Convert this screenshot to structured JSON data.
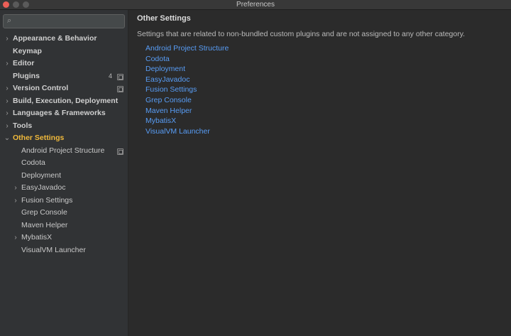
{
  "window": {
    "title": "Preferences"
  },
  "search": {
    "placeholder": "",
    "value": ""
  },
  "sidebar": {
    "items": [
      {
        "label": "Appearance & Behavior",
        "level": 0,
        "chevron": "›"
      },
      {
        "label": "Keymap",
        "level": 0,
        "chevron": ""
      },
      {
        "label": "Editor",
        "level": 0,
        "chevron": "›"
      },
      {
        "label": "Plugins",
        "level": 0,
        "chevron": "",
        "badge": "4",
        "copy_icon": true
      },
      {
        "label": "Version Control",
        "level": 0,
        "chevron": "›",
        "copy_icon": true
      },
      {
        "label": "Build, Execution, Deployment",
        "level": 0,
        "chevron": "›"
      },
      {
        "label": "Languages & Frameworks",
        "level": 0,
        "chevron": "›"
      },
      {
        "label": "Tools",
        "level": 0,
        "chevron": "›"
      },
      {
        "label": "Other Settings",
        "level": 0,
        "chevron": "⌄",
        "active": true
      },
      {
        "label": "Android Project Structure",
        "level": 1,
        "chevron": "",
        "copy_icon": true
      },
      {
        "label": "Codota",
        "level": 1,
        "chevron": ""
      },
      {
        "label": "Deployment",
        "level": 1,
        "chevron": ""
      },
      {
        "label": "EasyJavadoc",
        "level": 1,
        "chevron": "›"
      },
      {
        "label": "Fusion Settings",
        "level": 1,
        "chevron": "›"
      },
      {
        "label": "Grep Console",
        "level": 1,
        "chevron": ""
      },
      {
        "label": "Maven Helper",
        "level": 1,
        "chevron": ""
      },
      {
        "label": "MybatisX",
        "level": 1,
        "chevron": "›"
      },
      {
        "label": "VisualVM Launcher",
        "level": 1,
        "chevron": ""
      }
    ]
  },
  "main": {
    "title": "Other Settings",
    "description": "Settings that are related to non-bundled custom plugins and are not assigned to any other category.",
    "links": [
      "Android Project Structure",
      "Codota",
      "Deployment",
      "EasyJavadoc",
      "Fusion Settings",
      "Grep Console",
      "Maven Helper",
      "MybatisX",
      "VisualVM Launcher"
    ]
  },
  "colors": {
    "accent_active": "#f0b93b",
    "link": "#589df6",
    "close_button": "#ec5f57"
  }
}
